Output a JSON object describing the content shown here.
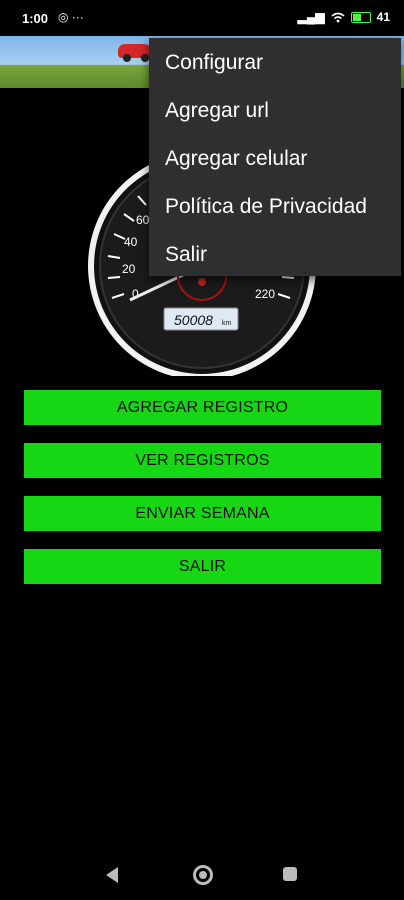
{
  "status_bar": {
    "time": "1:00",
    "left_icons": "◎ ···",
    "signal": "▂▄▆",
    "wifi": "wifi-icon",
    "battery_percent": "41"
  },
  "speedometer": {
    "ticks": [
      "0",
      "20",
      "40",
      "60",
      "220"
    ],
    "odometer": "50008",
    "odometer_unit": "km"
  },
  "buttons": {
    "add_record": "AGREGAR REGISTRO",
    "view_records": "VER REGISTROS",
    "send_week": "ENVIAR SEMANA",
    "exit": "SALIR"
  },
  "menu": {
    "items": [
      "Configurar",
      "Agregar url",
      "Agregar celular",
      "Política de Privacidad",
      "Salir"
    ]
  },
  "colors": {
    "button_green": "#17d613",
    "menu_bg": "#2f2f2f",
    "background": "#000000"
  }
}
